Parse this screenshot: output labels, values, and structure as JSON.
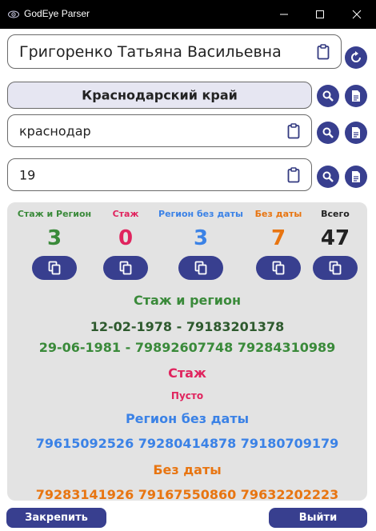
{
  "window": {
    "title": "GodEye Parser"
  },
  "inputs": {
    "name": "Григоренко Татьяна Васильевна",
    "region": "Краснодарский край",
    "city": "краснодар",
    "number": "19"
  },
  "stats": [
    {
      "label": "Стаж и Регион",
      "value": "3",
      "color": "#3a8a3a"
    },
    {
      "label": "Стаж",
      "value": "0",
      "color": "#e0245e"
    },
    {
      "label": "Регион без даты",
      "value": "3",
      "color": "#3b82e6"
    },
    {
      "label": "Без даты",
      "value": "7",
      "color": "#e87511"
    },
    {
      "label": "Всего",
      "value": "47",
      "color": "#222222"
    }
  ],
  "sections": {
    "stazh_region": {
      "title": "Стаж и регион",
      "lines": [
        "12-02-1978 - 79183201378",
        "29-06-1981 - 79892607748  79284310989"
      ]
    },
    "stazh": {
      "title": "Стаж",
      "empty": "Пусто"
    },
    "region_no_date": {
      "title": "Регион без даты",
      "lines": [
        "79615092526  79280414878  79180709179"
      ]
    },
    "no_date": {
      "title": "Без даты",
      "lines": [
        "79283141926  79167550860  79632202223"
      ]
    }
  },
  "buttons": {
    "pin": "Закрепить",
    "exit": "Выйти"
  },
  "colors": {
    "accent": "#383f8f",
    "green": "#3a8a3a",
    "pink": "#e0245e",
    "blue": "#3b82e6",
    "orange": "#e87511",
    "dark_green": "#2e5a2e"
  }
}
